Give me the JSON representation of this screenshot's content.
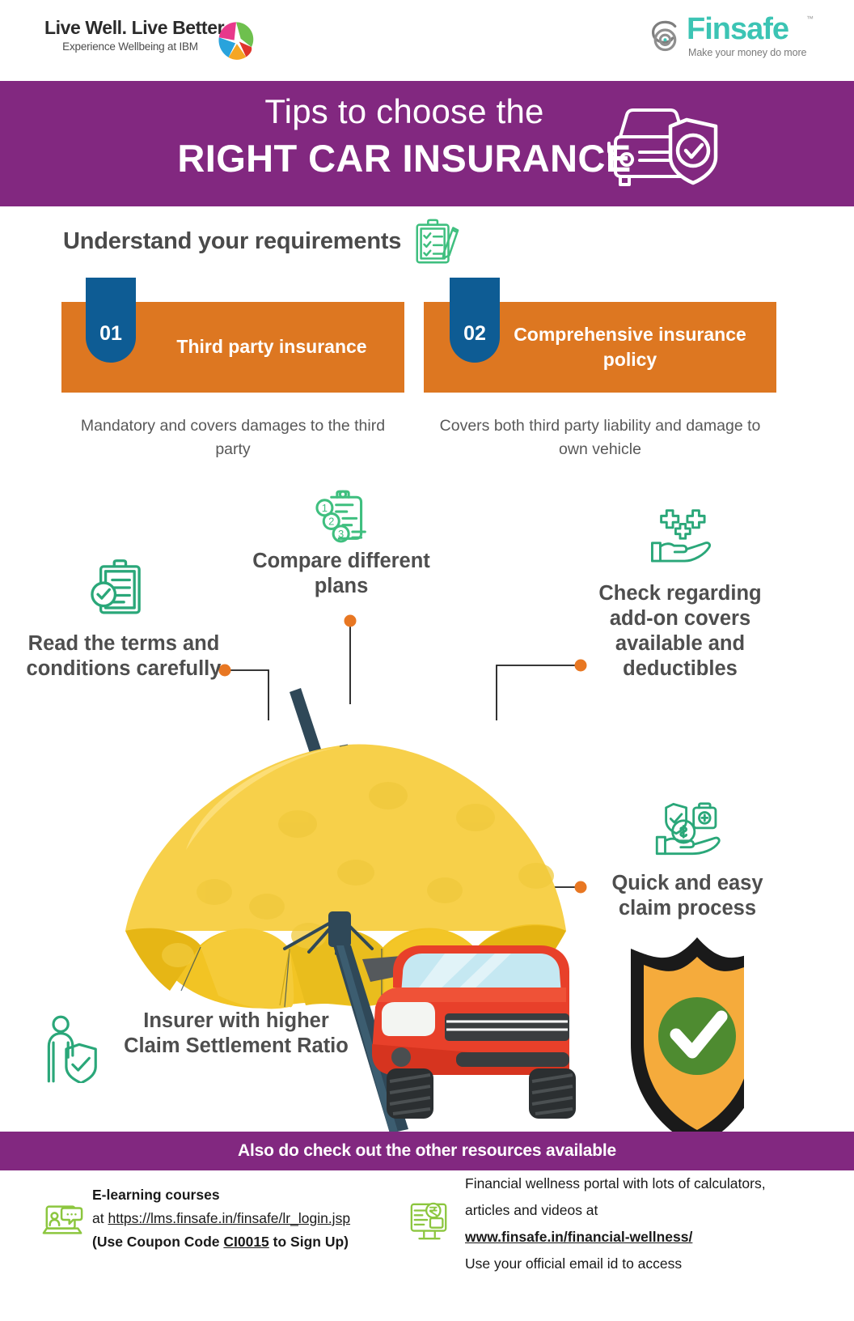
{
  "header": {
    "ibm_logo": {
      "line1": "Live Well. Live Better.",
      "line2": "Experience Wellbeing at IBM",
      "mark_name": "ibm-pinwheel-mark"
    },
    "finsafe_logo": {
      "name": "Finsafe",
      "tm": "™",
      "tagline": "Make your money do more",
      "mark_name": "finsafe-spiral-s-mark",
      "color": "#3cc4b4"
    }
  },
  "banner": {
    "title_line1": "Tips to choose the",
    "title_line2": "RIGHT CAR INSURANCE",
    "icon_name": "car-shield-icon",
    "background": "#822880"
  },
  "requirements": {
    "section_title": "Understand your requirements",
    "section_icon": "clipboard-checklist-pencil-icon",
    "cards": [
      {
        "number": "01",
        "label": "Third party insurance",
        "description": "Mandatory and covers damages to the third party",
        "badge_color": "#0e5c94",
        "card_color": "#dd7721"
      },
      {
        "number": "02",
        "label": "Comprehensive insurance policy",
        "description": "Covers both third party liability and damage to own vehicle",
        "badge_color": "#0e5c94",
        "card_color": "#dd7721"
      }
    ]
  },
  "features": [
    {
      "id": "read-terms",
      "label": "Read the terms and conditions carefully",
      "icon": "clipboard-check-icon"
    },
    {
      "id": "compare-plans",
      "label": "Compare different plans",
      "icon": "numbered-list-clipboard-icon"
    },
    {
      "id": "add-on-covers",
      "label": "Check regarding add-on covers available and deductibles",
      "icon": "hand-with-plus-signs-icon"
    },
    {
      "id": "claim-process",
      "label": "Quick and easy claim process",
      "icon": "hand-shield-coin-icon"
    },
    {
      "id": "claim-settlement-ratio",
      "label": "Insurer with higher Claim Settlement Ratio",
      "icon": "person-with-shield-icon"
    }
  ],
  "illustration": {
    "umbrella_name": "yellow-umbrella",
    "car_name": "red-car-front",
    "shield_name": "shield-with-green-check",
    "umbrella_color": "#f5cf3f",
    "car_color": "#e8402a",
    "shield_color": "#f5ab3c"
  },
  "footer": {
    "strip_text": "Also do check out the other resources available",
    "strip_color": "#822880",
    "left": {
      "icon": "e-learning-laptop-icon",
      "line1_bold": "E-learning  courses",
      "line2_prefix": "at ",
      "line2_link": "https://lms.finsafe.in/finsafe/lr_login.jsp",
      "line3_pre": "(Use Coupon Code ",
      "line3_code": "CI0015",
      "line3_post": " to Sign Up)"
    },
    "right": {
      "icon": "financial-wellness-monitor-icon",
      "line1": "Financial wellness portal with lots of calculators,",
      "line2": "articles and videos at",
      "line3_link": "www.finsafe.in/financial-wellness/",
      "line4": "Use your official email id to access"
    }
  }
}
